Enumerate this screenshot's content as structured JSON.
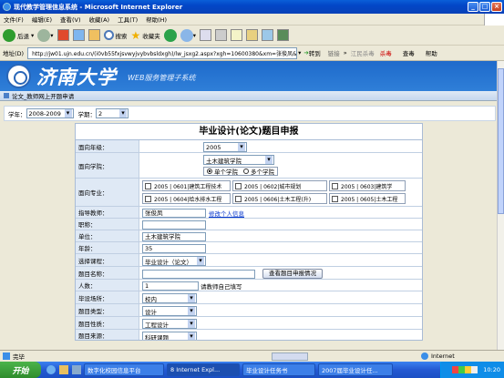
{
  "window": {
    "title": "现代教学管理信息系统 - Microsoft Internet Explorer"
  },
  "menu": [
    "文件(F)",
    "编辑(E)",
    "查看(V)",
    "收藏(A)",
    "工具(T)",
    "帮助(H)"
  ],
  "toolbar": {
    "back": "后退",
    "search": "搜索",
    "favorites": "收藏夹"
  },
  "address": {
    "label": "地址(D)",
    "url": "http://jw01.ujn.edu.cn/(i0vb55fxjsvwyjvybvbsldxgh)/lw_jsxg2.aspx?xgh=10600380&xm=张俊凤&gn",
    "go": "转到",
    "links": "链接",
    "ext1": "江民杀毒",
    "ext2": "杀毒",
    "ext3": "查毒",
    "ext4": "帮助"
  },
  "banner": {
    "calligraphy": "济南大学",
    "subtitle": "WEB服务管理子系统"
  },
  "crumb": "论文_教师网上开题申请",
  "filter": {
    "year_label": "学年：",
    "year_value": "2008-2009",
    "term_label": "学期：",
    "term_value": "2"
  },
  "form": {
    "title": "毕业设计(论文)题目申报",
    "grade_label": "面向年级：",
    "grade_value": "2005",
    "college_label": "面向学院：",
    "college_value": "土木建筑学院",
    "radio_single": "单个学院",
    "radio_multi": "多个学院",
    "major_label": "面向专业：",
    "majors": [
      "2005 | 0601|建筑工程技术",
      "2005 | 0602|城市规划",
      "2005 | 0603|建筑学",
      "2005 | 0604|给水排水工程",
      "2005 | 0606|土木工程(升)",
      "2005 | 0605|土木工程"
    ],
    "advisor_label": "指导教师：",
    "advisor_value": "张俊凤",
    "advisor_link": "修改个人信息",
    "title_label": "职称：",
    "unit_label": "单位：",
    "unit_value": "土木建筑学院",
    "age_label": "年龄：",
    "age_value": "35",
    "course_label": "选择课程：",
    "course_value": "毕业设计（论文）",
    "topic_label": "题目名称：",
    "topic_button": "查看题目申报情况",
    "count_label": "人数：",
    "count_value": "1",
    "count_hint": "请教师自己填写",
    "place_label": "毕设场所：",
    "place_value": "校内",
    "type_label": "题目类型：",
    "type_value": "设计",
    "nature_label": "题目性质：",
    "nature_value": "工程设计",
    "source_label": "题目来源：",
    "source_value": "科研课题"
  },
  "status": {
    "left": "完毕",
    "zone": "Internet"
  },
  "taskbar": {
    "start": "开始",
    "tasks": [
      "数字化校园信息平台",
      "8 Internet Expl...",
      "毕业设计任务书",
      "2007届毕业设计任..."
    ],
    "clock": "10:20"
  }
}
